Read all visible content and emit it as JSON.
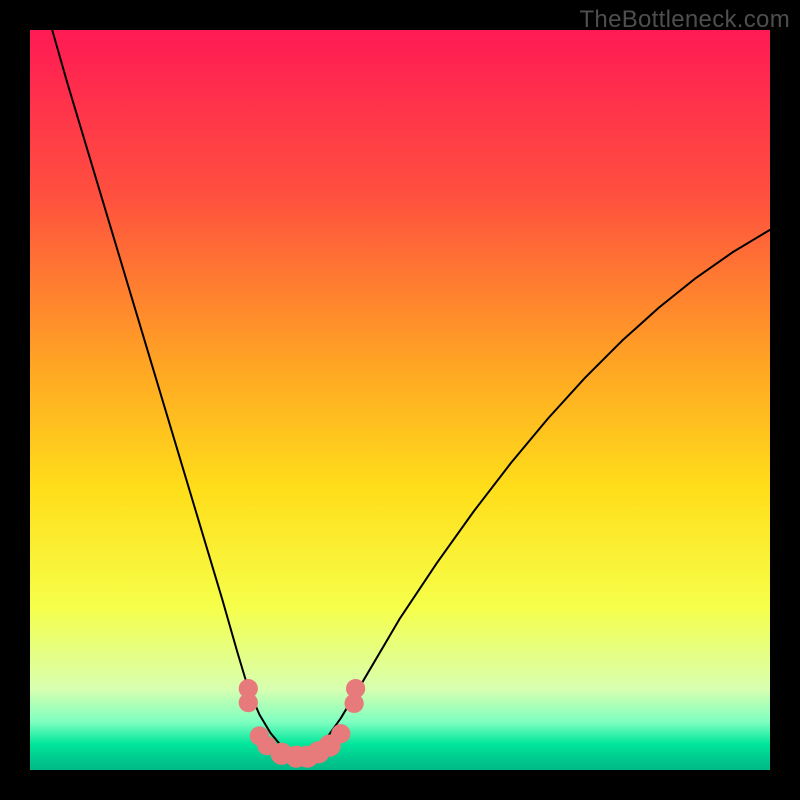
{
  "watermark": "TheBottleneck.com",
  "chart_data": {
    "type": "line",
    "title": "",
    "xlabel": "",
    "ylabel": "",
    "xlim": [
      0,
      100
    ],
    "ylim": [
      0,
      100
    ],
    "gradient_stops": [
      {
        "offset": 0,
        "color": "#ff1a54"
      },
      {
        "offset": 0.22,
        "color": "#ff4f3f"
      },
      {
        "offset": 0.45,
        "color": "#ffa424"
      },
      {
        "offset": 0.62,
        "color": "#ffde1a"
      },
      {
        "offset": 0.78,
        "color": "#f6ff4a"
      },
      {
        "offset": 0.89,
        "color": "#d8ffb0"
      },
      {
        "offset": 0.935,
        "color": "#7effc0"
      },
      {
        "offset": 0.965,
        "color": "#00e69b"
      },
      {
        "offset": 0.985,
        "color": "#00c98e"
      },
      {
        "offset": 1.0,
        "color": "#00b987"
      }
    ],
    "series": [
      {
        "name": "curve-1",
        "x": [
          3,
          5,
          8,
          11,
          14,
          17,
          20,
          23,
          26,
          28,
          29.5,
          31,
          32.5,
          34,
          35.5,
          37
        ],
        "y": [
          100,
          93,
          83,
          73,
          63,
          53,
          43,
          33,
          23,
          16,
          11,
          7.5,
          5,
          3.2,
          2.2,
          1.7
        ]
      },
      {
        "name": "curve-2",
        "x": [
          37,
          38.5,
          40,
          42,
          45,
          50,
          55,
          60,
          65,
          70,
          75,
          80,
          85,
          90,
          95,
          100
        ],
        "y": [
          1.7,
          2.6,
          4.2,
          7,
          12,
          20.5,
          28,
          35,
          41.5,
          47.5,
          53,
          58,
          62.5,
          66.5,
          70,
          73
        ]
      }
    ],
    "markers": {
      "color": "#e77b7b",
      "points": [
        {
          "x": 29.5,
          "y": 11,
          "r": 1.3
        },
        {
          "x": 29.5,
          "y": 9.1,
          "r": 1.3
        },
        {
          "x": 31.0,
          "y": 4.6,
          "r": 1.3
        },
        {
          "x": 32.0,
          "y": 3.3,
          "r": 1.3
        },
        {
          "x": 34.0,
          "y": 2.2,
          "r": 1.5
        },
        {
          "x": 36.0,
          "y": 1.8,
          "r": 1.5
        },
        {
          "x": 37.5,
          "y": 1.8,
          "r": 1.5
        },
        {
          "x": 39.0,
          "y": 2.4,
          "r": 1.5
        },
        {
          "x": 40.5,
          "y": 3.3,
          "r": 1.5
        },
        {
          "x": 42.0,
          "y": 4.9,
          "r": 1.3
        },
        {
          "x": 43.8,
          "y": 9.0,
          "r": 1.3
        },
        {
          "x": 44.0,
          "y": 11.0,
          "r": 1.3
        }
      ]
    }
  }
}
